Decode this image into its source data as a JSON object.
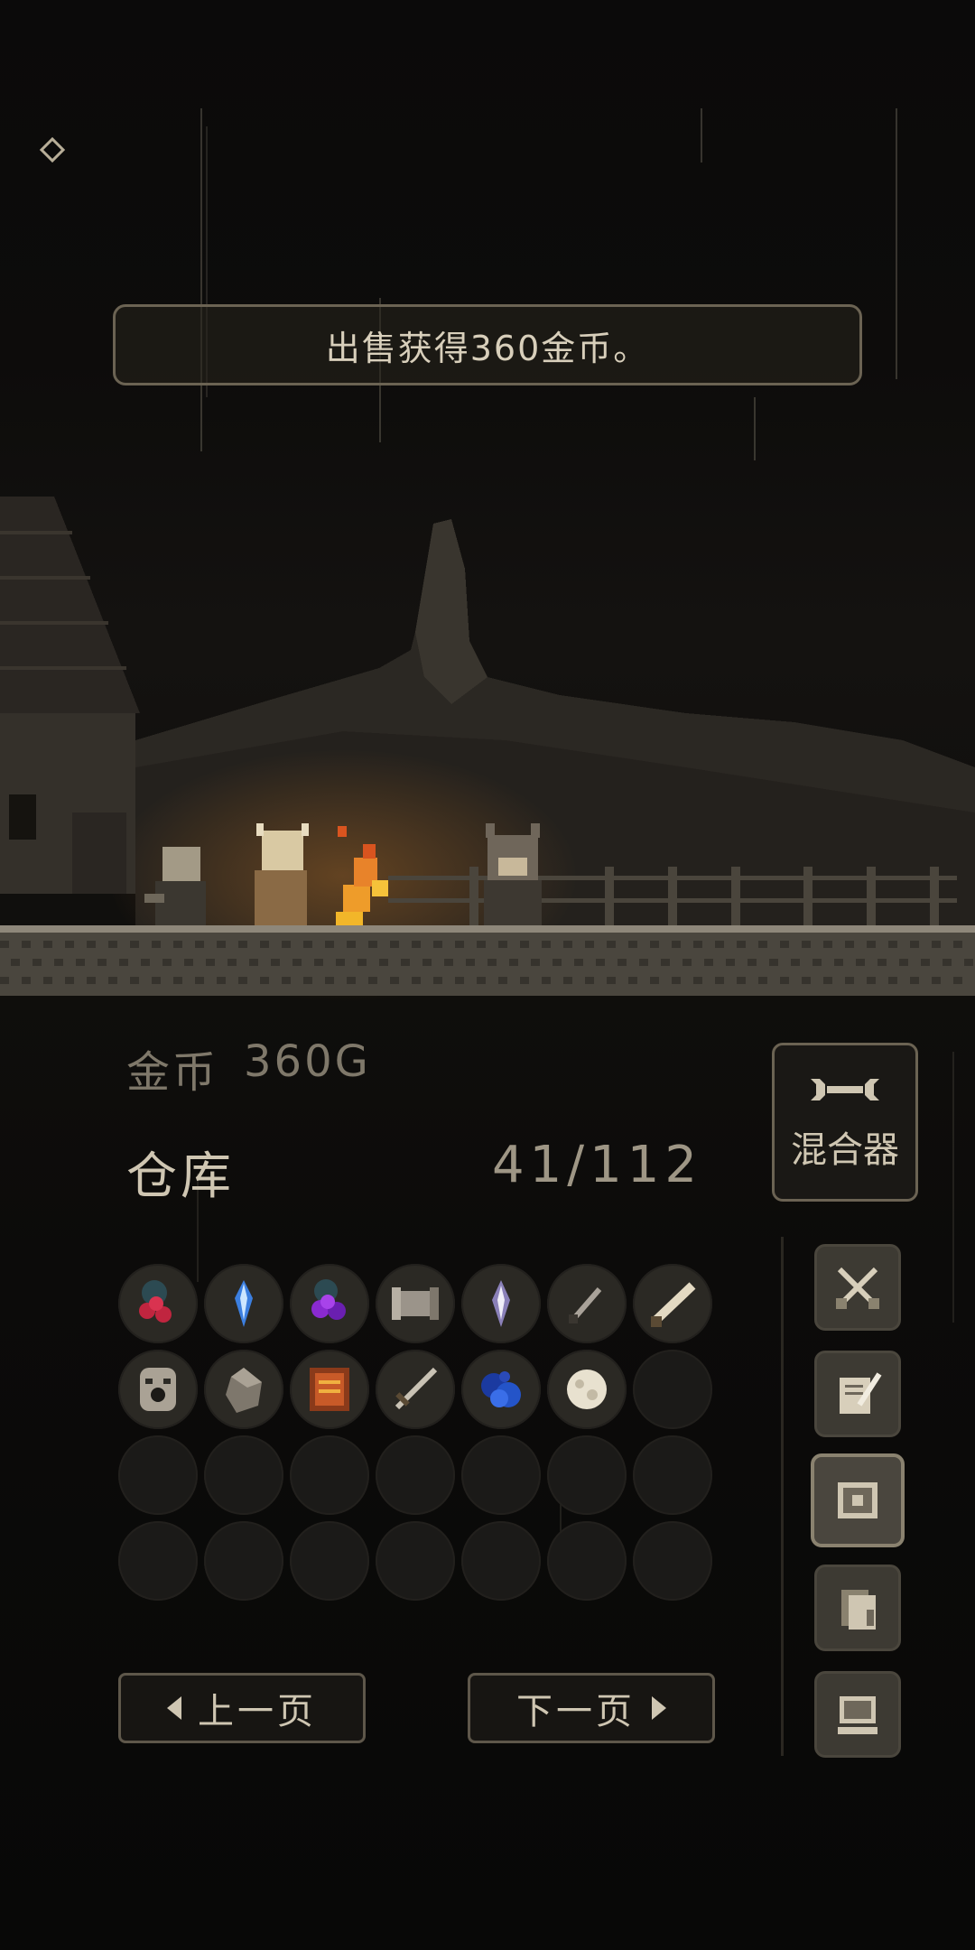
{
  "toast": {
    "message": "出售获得360金币。"
  },
  "gold": {
    "label": "金币",
    "value": "360G"
  },
  "storage": {
    "label": "仓库",
    "count": "41/112"
  },
  "mixer": {
    "label": "混合器",
    "icon": "wrench-icon"
  },
  "inventory": {
    "items": [
      {
        "icon": "red-berries-icon"
      },
      {
        "icon": "blue-crystal-icon"
      },
      {
        "icon": "purple-grapes-icon"
      },
      {
        "icon": "scroll-icon"
      },
      {
        "icon": "white-crystal-icon"
      },
      {
        "icon": "dagger-icon"
      },
      {
        "icon": "sword-icon"
      },
      {
        "icon": "skull-mask-icon"
      },
      {
        "icon": "stone-icon"
      },
      {
        "icon": "spellbook-icon"
      },
      {
        "icon": "longsword-icon"
      },
      {
        "icon": "blue-orb-icon"
      },
      {
        "icon": "moon-orb-icon"
      }
    ],
    "total_slots": 28
  },
  "side_menu": [
    {
      "icon": "crossed-swords-icon"
    },
    {
      "icon": "quill-paper-icon"
    },
    {
      "icon": "storage-box-icon"
    },
    {
      "icon": "documents-icon"
    },
    {
      "icon": "computer-icon"
    }
  ],
  "pagination": {
    "prev_label": "上一页",
    "next_label": "下一页"
  },
  "colors": {
    "text": "#cfc6b2",
    "fire": "#e8832a",
    "panel_border": "#6b6353"
  }
}
